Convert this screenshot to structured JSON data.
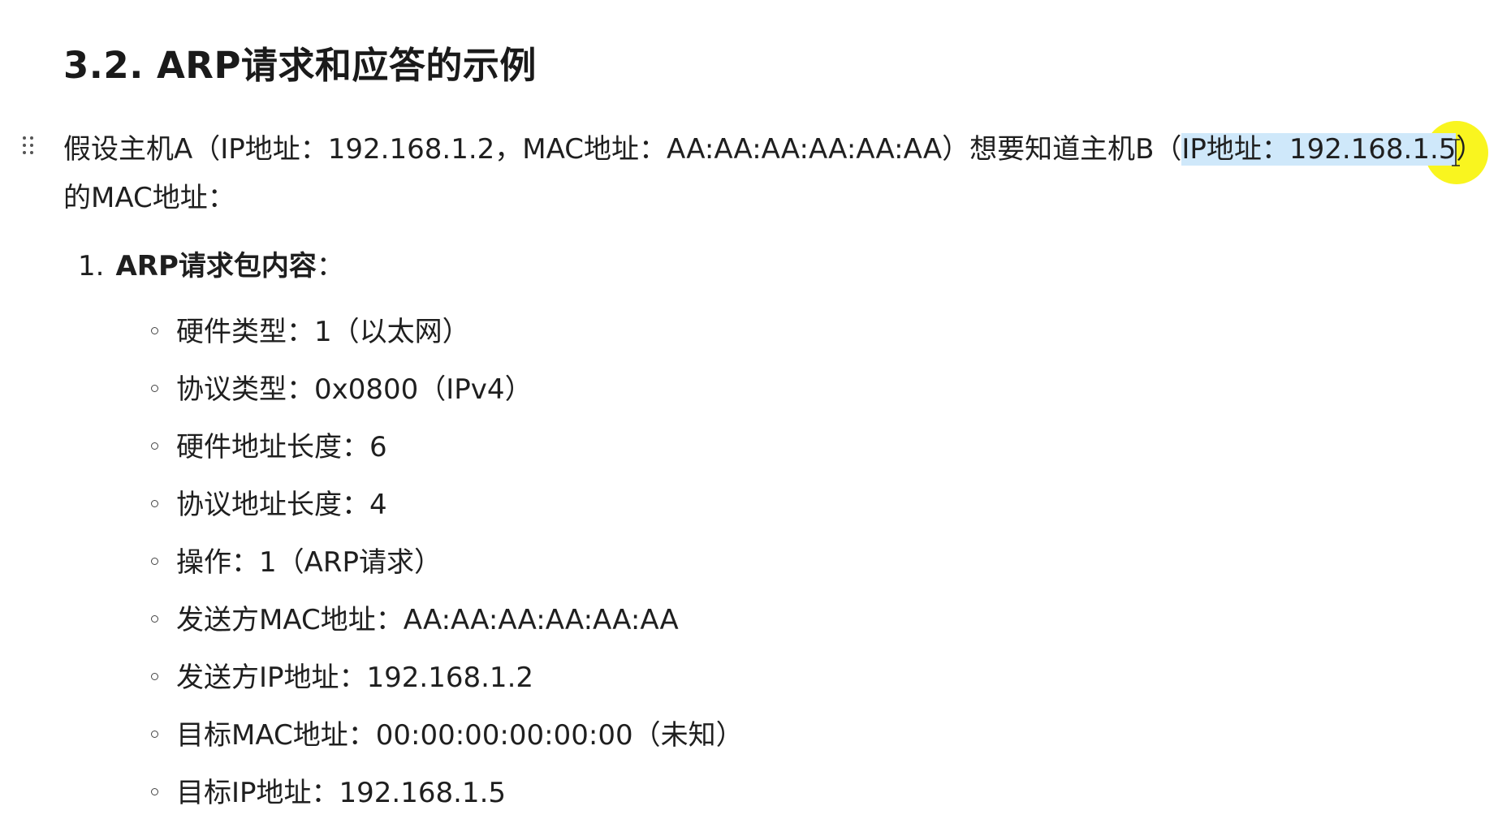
{
  "heading": "3.2. ARP请求和应答的示例",
  "intro": {
    "line1_before_highlight": "假设主机A（IP地址：192.168.1.2，MAC地址：AA:AA:AA:AA:AA:AA）想要知道主机B（",
    "line1_highlight": "IP地址：192.168.1.5",
    "line1_after_highlight": "）",
    "line2": "的MAC地址："
  },
  "section": {
    "number": "1.",
    "title": "ARP请求包内容",
    "title_suffix": "：",
    "items": [
      "硬件类型：1（以太网）",
      "协议类型：0x0800（IPv4）",
      "硬件地址长度：6",
      "协议地址长度：4",
      "操作：1（ARP请求）",
      "发送方MAC地址：AA:AA:AA:AA:AA:AA",
      "发送方IP地址：192.168.1.2",
      "目标MAC地址：00:00:00:00:00:00（未知）",
      "目标IP地址：192.168.1.5"
    ]
  },
  "colors": {
    "selection_highlight": "#cfe8fa",
    "cursor_marker": "#f8f400"
  },
  "icons": [
    "drag-handle-icon",
    "text-cursor-icon"
  ]
}
